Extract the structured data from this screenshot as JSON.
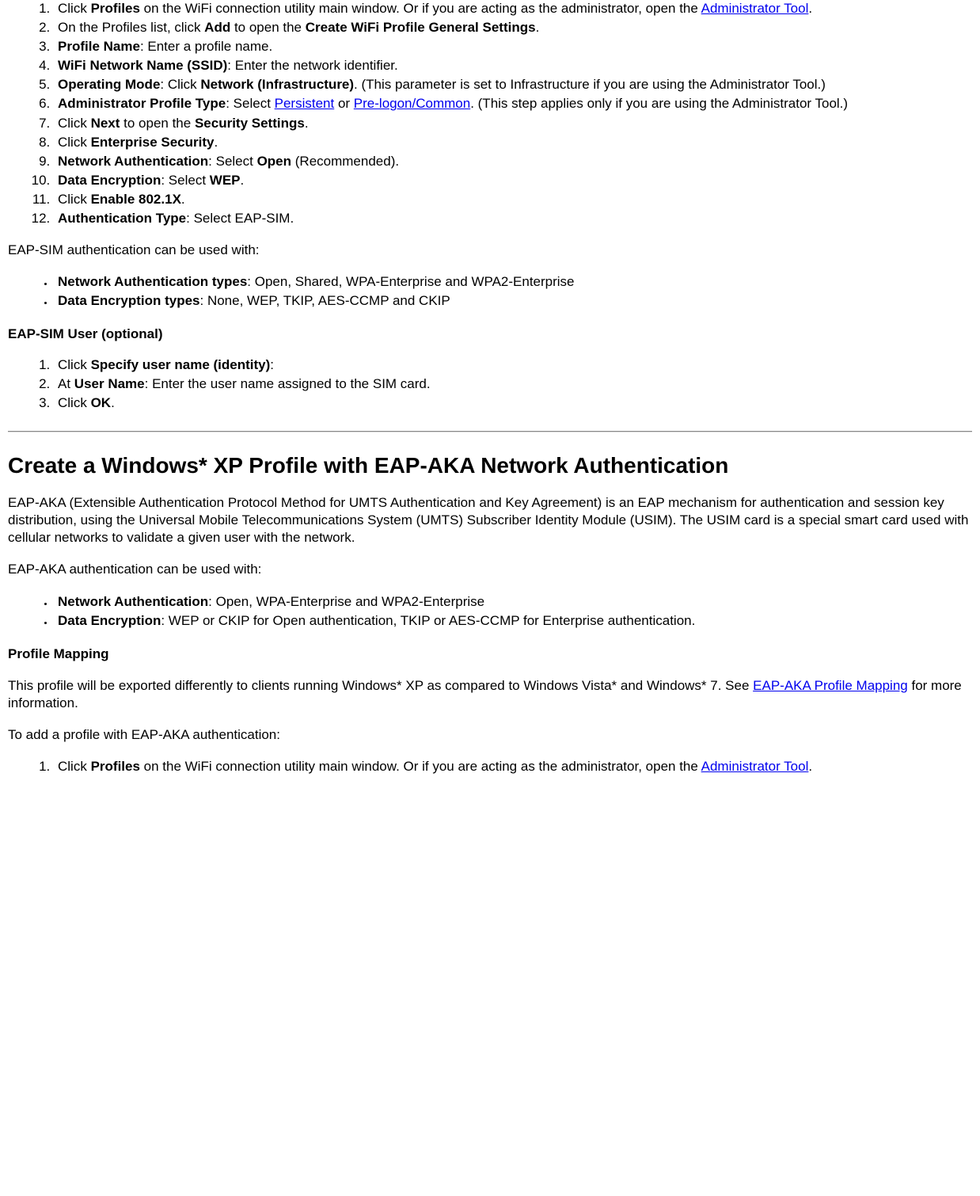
{
  "steps1": {
    "i1_a": "Click ",
    "i1_b": "Profiles",
    "i1_c": " on the WiFi connection utility main window. Or if you are acting as the administrator, open the ",
    "i1_link": "Administrator Tool",
    "i1_d": ".",
    "i2_a": "On the Profiles list, click ",
    "i2_b": "Add",
    "i2_c": " to open the ",
    "i2_d": "Create WiFi Profile General Settings",
    "i2_e": ".",
    "i3_a": "Profile Name",
    "i3_b": ": Enter a profile name.",
    "i4_a": "WiFi Network Name (SSID)",
    "i4_b": ": Enter the network identifier.",
    "i5_a": "Operating Mode",
    "i5_b": ": Click ",
    "i5_c": "Network (Infrastructure)",
    "i5_d": ". (This parameter is set to Infrastructure if you are using the Administrator Tool.)",
    "i6_a": "Administrator Profile Type",
    "i6_b": ": Select ",
    "i6_link1": "Persistent",
    "i6_c": " or ",
    "i6_link2": "Pre-logon/Common",
    "i6_d": ". (This step applies only if you are using the Administrator Tool.)",
    "i7_a": "Click ",
    "i7_b": "Next",
    "i7_c": " to open the ",
    "i7_d": "Security Settings",
    "i7_e": ".",
    "i8_a": "Click ",
    "i8_b": "Enterprise Security",
    "i8_c": ".",
    "i9_a": "Network Authentication",
    "i9_b": ": Select ",
    "i9_c": "Open",
    "i9_d": " (Recommended).",
    "i10_a": "Data Encryption",
    "i10_b": ": Select ",
    "i10_c": "WEP",
    "i10_d": ".",
    "i11_a": "Click ",
    "i11_b": "Enable 802.1X",
    "i11_c": ".",
    "i12_a": "Authentication Type",
    "i12_b": ": Select EAP-SIM."
  },
  "para1": "EAP-SIM authentication can be used with:",
  "bullets1": {
    "b1_a": "Network Authentication types",
    "b1_b": ": Open, Shared, WPA-Enterprise and WPA2-Enterprise",
    "b2_a": "Data Encryption types",
    "b2_b": ": None, WEP, TKIP, AES-CCMP and CKIP"
  },
  "heading1": "EAP-SIM User (optional)",
  "steps2": {
    "i1_a": "Click ",
    "i1_b": "Specify user name (identity)",
    "i1_c": ":",
    "i2_a": "At ",
    "i2_b": "User Name",
    "i2_c": ": Enter the user name assigned to the SIM card.",
    "i3_a": "Click ",
    "i3_b": "OK",
    "i3_c": "."
  },
  "heading2": "Create a Windows* XP Profile with EAP-AKA Network Authentication",
  "para2": "EAP-AKA (Extensible Authentication Protocol Method for UMTS Authentication and Key Agreement) is an EAP mechanism for authentication and session key distribution, using the Universal Mobile Telecommunications System (UMTS) Subscriber Identity Module (USIM). The USIM card is a special smart card used with cellular networks to validate a given user with the network.",
  "para3": "EAP-AKA authentication can be used with:",
  "bullets2": {
    "b1_a": "Network Authentication",
    "b1_b": ": Open, WPA-Enterprise and WPA2-Enterprise",
    "b2_a": "Data Encryption",
    "b2_b": ": WEP or CKIP for Open authentication, TKIP or AES-CCMP for Enterprise authentication."
  },
  "heading3": "Profile Mapping",
  "para4_a": "This profile will be exported differently to clients running Windows* XP as compared to Windows Vista* and Windows* 7. See ",
  "para4_link": "EAP-AKA Profile Mapping",
  "para4_b": " for more information.",
  "para5": "To add a profile with EAP-AKA authentication:",
  "steps3": {
    "i1_a": "Click ",
    "i1_b": "Profiles",
    "i1_c": " on the WiFi connection utility main window. Or if you are acting as the administrator, open the ",
    "i1_link": "Administrator Tool",
    "i1_d": "."
  }
}
